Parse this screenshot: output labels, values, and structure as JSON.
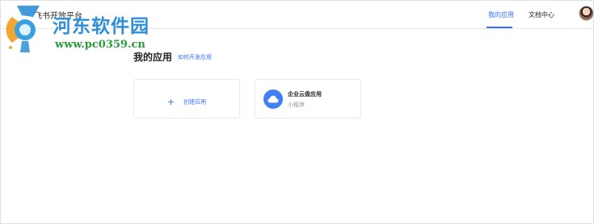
{
  "header": {
    "brand_text": "飞书开放平台",
    "nav": [
      {
        "label": "我的应用",
        "active": true
      },
      {
        "label": "文档中心",
        "active": false
      }
    ]
  },
  "watermark": {
    "title": "河东软件园",
    "url": "www.pc0359.cn"
  },
  "main": {
    "title": "我的应用",
    "howto_link": "如何开发应用",
    "create_card": {
      "label": "创建应用",
      "icon": "plus-icon"
    },
    "apps": [
      {
        "name": "企业云盘应用",
        "type": "小程序",
        "icon": "cloud-icon",
        "color": "#4080f5"
      }
    ]
  },
  "colors": {
    "accent": "#3370ff",
    "muted": "#8f959e",
    "border": "#e8e9eb"
  }
}
